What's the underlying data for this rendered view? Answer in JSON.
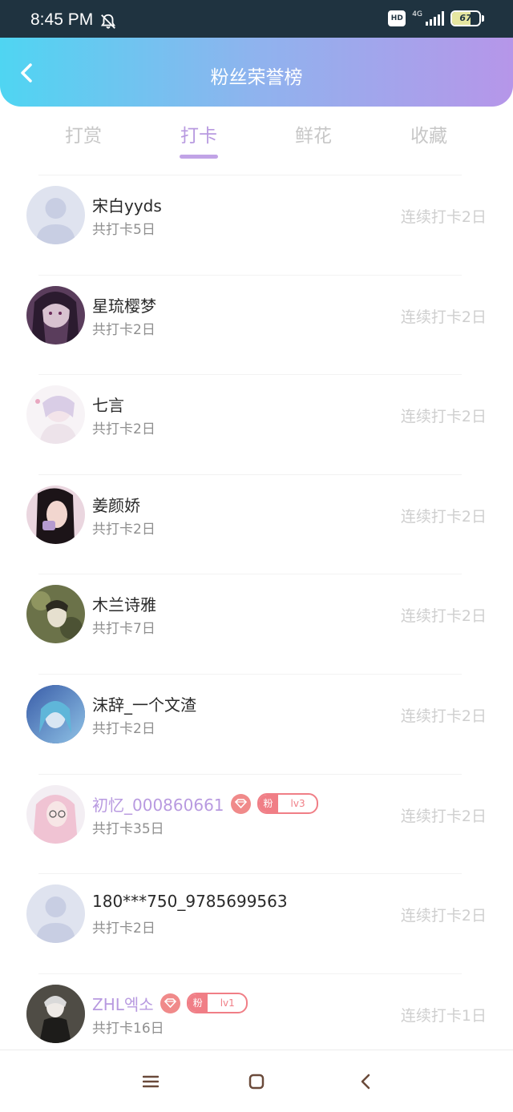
{
  "status_bar": {
    "time": "8:45 PM",
    "hd_label": "HD",
    "network_label": "4G",
    "battery_level": "67",
    "icons": [
      "bell-off-icon",
      "hd-icon",
      "signal-icon",
      "battery-icon"
    ]
  },
  "header": {
    "title": "粉丝荣誉榜",
    "back_icon": "chevron-left-icon",
    "gradient_colors": [
      "#4fd5f2",
      "#8fb3ee",
      "#b696e9"
    ]
  },
  "tabs": [
    {
      "label": "打赏",
      "active": false
    },
    {
      "label": "打卡",
      "active": true
    },
    {
      "label": "鲜花",
      "active": false
    },
    {
      "label": "收藏",
      "active": false
    }
  ],
  "accent_color": "#b89ae0",
  "fans": [
    {
      "name": "宋白yyds",
      "total": "共打卡5日",
      "streak": "连续打卡2日",
      "avatar": "default"
    },
    {
      "name": "星琉樱梦",
      "total": "共打卡2日",
      "streak": "连续打卡2日",
      "avatar": "purple-anime"
    },
    {
      "name": "七言",
      "total": "共打卡2日",
      "streak": "连续打卡2日",
      "avatar": "light-anime"
    },
    {
      "name": "姜颜娇",
      "total": "共打卡2日",
      "streak": "连续打卡2日",
      "avatar": "pink-photo"
    },
    {
      "name": "木兰诗雅",
      "total": "共打卡7日",
      "streak": "连续打卡2日",
      "avatar": "green-art"
    },
    {
      "name": "沫辞_一个文渣",
      "total": "共打卡2日",
      "streak": "连续打卡2日",
      "avatar": "blue-anime"
    },
    {
      "name": "初忆_000860661",
      "total": "共打卡35日",
      "streak": "连续打卡2日",
      "avatar": "pink-anime",
      "vip": true,
      "fan_label": "粉",
      "fan_level": "lv3"
    },
    {
      "name": "180***750_9785699563",
      "total": "共打卡2日",
      "streak": "连续打卡2日",
      "avatar": "default"
    },
    {
      "name": "ZHL엑소",
      "total": "共打卡16日",
      "streak": "连续打卡1日",
      "avatar": "dark-anime",
      "vip": true,
      "fan_label": "粉",
      "fan_level": "lv1"
    }
  ],
  "nav_bar": {
    "icons": [
      "menu-icon",
      "home-square-icon",
      "back-arrow-icon"
    ]
  }
}
